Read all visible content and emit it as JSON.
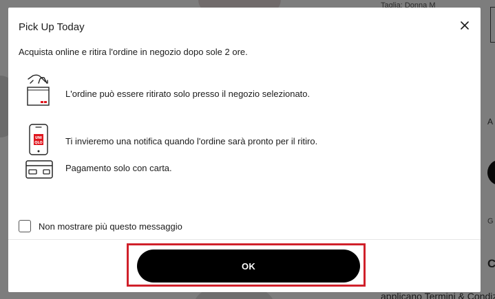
{
  "background": {
    "size_text": "Taglia: Donna M",
    "partial_text_1": "A",
    "partial_text_2": "G",
    "partial_text_3": "C",
    "terms_text": "applicano Termini & Condiz"
  },
  "modal": {
    "title": "Pick Up Today",
    "close_icon": "close-icon",
    "intro": "Acquista online e ritira l'ordine in negozio dopo sole 2 ore.",
    "features": [
      {
        "icon": "store-bag-icon",
        "text": "L'ordine può essere ritirato solo presso il negozio selezionato."
      },
      {
        "icon": "phone-notification-icon",
        "text": "Ti invieremo una notifica quando l'ordine sarà pronto per il ritiro."
      },
      {
        "icon": "credit-card-icon",
        "text": "Pagamento solo con carta."
      }
    ],
    "phone_brand": [
      "UNI",
      "QLO"
    ],
    "checkbox_label": "Non mostrare più questo messaggio",
    "checkbox_checked": false,
    "ok_label": "OK"
  },
  "colors": {
    "brand_red": "#e0161e",
    "highlight_red": "#d0202a",
    "button_black": "#000000"
  }
}
